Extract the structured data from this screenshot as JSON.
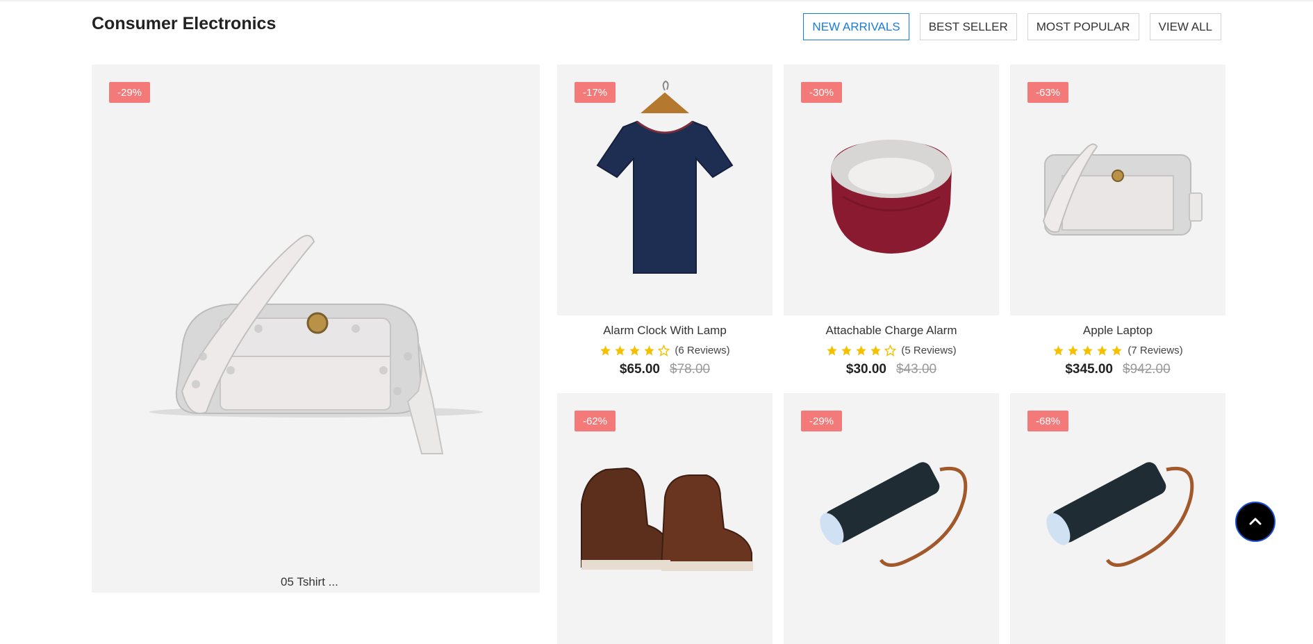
{
  "section": {
    "title": "Consumer Electronics"
  },
  "filters": [
    {
      "label": "NEW ARRIVALS",
      "active": true
    },
    {
      "label": "BEST SELLER",
      "active": false
    },
    {
      "label": "MOST POPULAR",
      "active": false
    },
    {
      "label": "VIEW ALL",
      "active": false
    }
  ],
  "featured": {
    "discount": "-29%",
    "image": "handbag-image",
    "caption": "05 Tshirt ..."
  },
  "products": [
    {
      "discount": "-17%",
      "image": "tshirt-image",
      "name": "Alarm Clock With Lamp",
      "rating": 4,
      "reviews": "(6 Reviews)",
      "price": "$65.00",
      "old_price": "$78.00"
    },
    {
      "discount": "-30%",
      "image": "headband-image",
      "name": "Attachable Charge Alarm",
      "rating": 4,
      "reviews": "(5 Reviews)",
      "price": "$30.00",
      "old_price": "$43.00"
    },
    {
      "discount": "-63%",
      "image": "handbag-image",
      "name": "Apple Laptop",
      "rating": 5,
      "reviews": "(7 Reviews)",
      "price": "$345.00",
      "old_price": "$942.00"
    },
    {
      "discount": "-62%",
      "image": "boots-image"
    },
    {
      "discount": "-29%",
      "image": "flashlight-image"
    },
    {
      "discount": "-68%",
      "image": "flashlight-image"
    }
  ],
  "colors": {
    "accent": "#1a7cd9",
    "badge": "#f47a7a",
    "star": "#f5c000",
    "card_bg": "#f3f3f3"
  },
  "scroll_top": {
    "icon": "chevron-up-icon"
  }
}
